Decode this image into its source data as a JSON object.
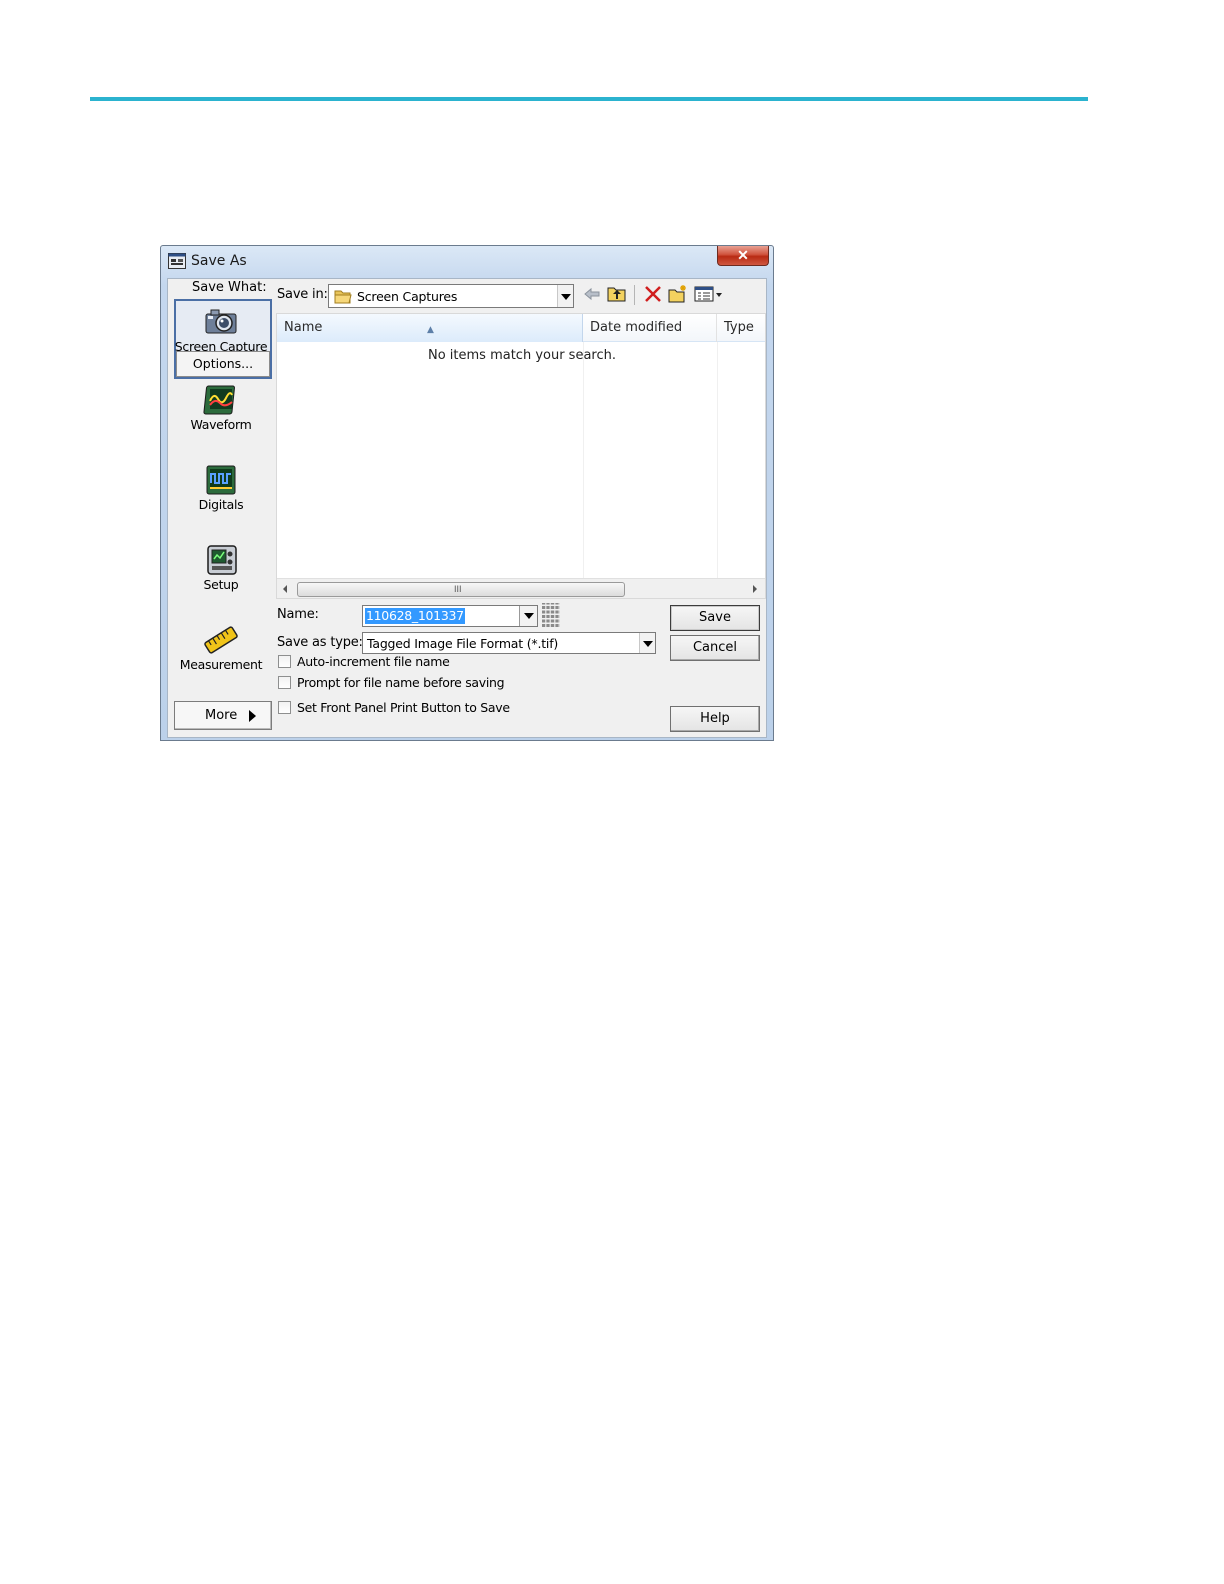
{
  "dialog": {
    "title": "Save As",
    "close_label": "✕"
  },
  "left_panel": {
    "header": "Save What:",
    "items": [
      {
        "label": "Screen Capture",
        "icon": "camera-icon",
        "selected": true
      },
      {
        "label": "Waveform",
        "icon": "waveform-icon"
      },
      {
        "label": "Digitals",
        "icon": "digitals-icon"
      },
      {
        "label": "Setup",
        "icon": "setup-icon"
      },
      {
        "label": "Measurement",
        "icon": "measurement-ruler-icon"
      }
    ],
    "options_label": "Options...",
    "more_label": "More"
  },
  "save_in": {
    "label": "Save in:",
    "value": "Screen Captures",
    "folder_icon": "folder-icon"
  },
  "toolbar": {
    "icons": [
      "back-arrow-icon",
      "up-folder-icon",
      "delete-icon",
      "new-folder-icon",
      "view-menu-icon"
    ]
  },
  "file_list": {
    "columns": [
      "Name",
      "Date modified",
      "Type"
    ],
    "sorted_column": "Name",
    "empty_message": "No items match your search.",
    "scroll_grip": "III"
  },
  "form": {
    "name_label": "Name:",
    "name_value": "110628_101337",
    "type_label": "Save as type:",
    "type_value": "Tagged Image File Format (*.tif)",
    "checkboxes": [
      {
        "label": "Auto-increment file name",
        "checked": false
      },
      {
        "label": "Prompt for file name before saving",
        "checked": false
      },
      {
        "label": "Set Front Panel Print Button to Save",
        "checked": false
      }
    ]
  },
  "buttons": {
    "save": "Save",
    "cancel": "Cancel",
    "help": "Help"
  },
  "colors": {
    "accent_rule": "#2bb3cf",
    "selection": "#3399ff",
    "close_button": "#c8432c"
  }
}
